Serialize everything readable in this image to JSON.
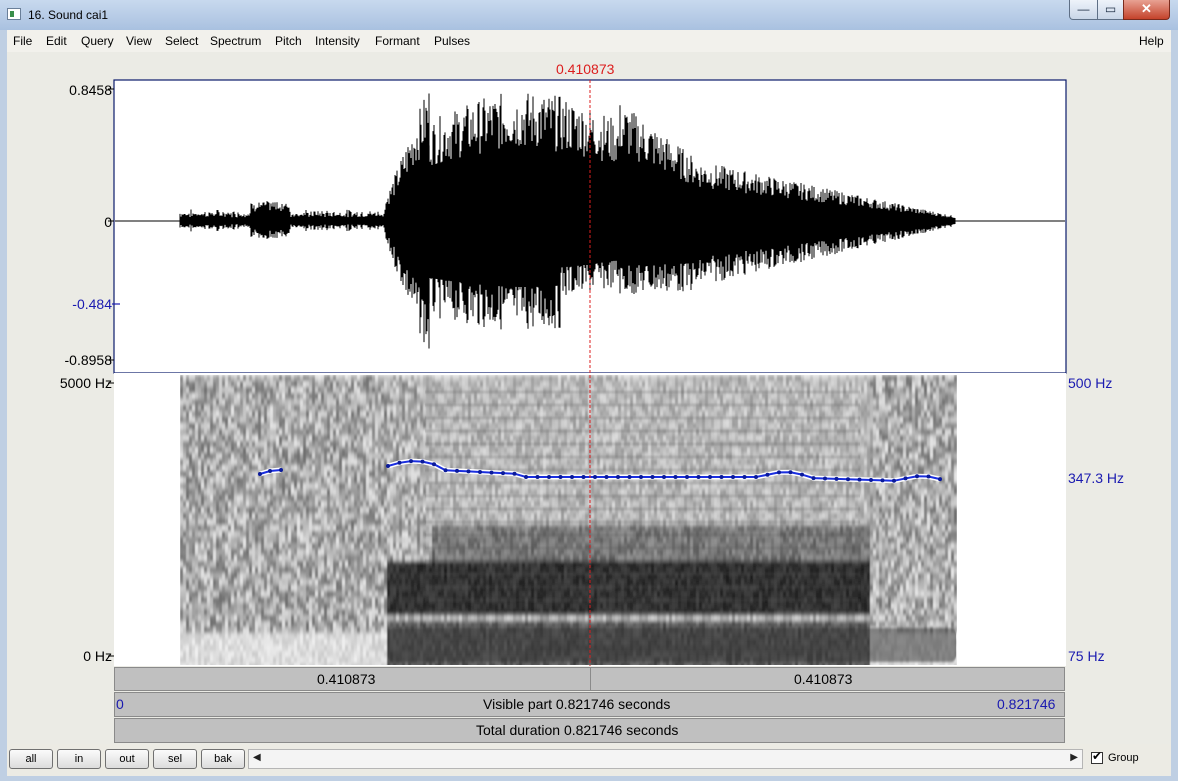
{
  "window": {
    "title": "16. Sound cai1",
    "min_glyph": "—",
    "max_glyph": "▭",
    "close_glyph": "✕"
  },
  "menu": [
    "File",
    "Edit",
    "Query",
    "View",
    "Select",
    "Spectrum",
    "Pitch",
    "Intensity",
    "Formant",
    "Pulses"
  ],
  "help_label": "Help",
  "cursor": {
    "time_label": "0.410873",
    "time": 0.410873
  },
  "waveform": {
    "y_top": "0.8458",
    "y_zero": "0",
    "y_bottom": "-0.8958",
    "marker": "-0.484"
  },
  "spectrogram": {
    "freq_top": "5000 Hz",
    "freq_bottom": "0 Hz",
    "pitch_top": "500 Hz",
    "pitch_value": "347.3 Hz",
    "pitch_bottom": "75 Hz"
  },
  "bars": {
    "left_time": "0.410873",
    "right_time": "0.410873",
    "visible_start": "0",
    "visible_end": "0.821746",
    "visible_text": "Visible part 0.821746 seconds",
    "total_text": "Total duration 0.821746 seconds"
  },
  "buttons": [
    "all",
    "in",
    "out",
    "sel",
    "bak"
  ],
  "group": {
    "label": "Group",
    "checked": true,
    "check_glyph": "✔"
  },
  "scroll": {
    "left_arrow": "◀",
    "right_arrow": "▶"
  },
  "colors": {
    "cursor": "#dc1e1e",
    "pitch": "#1a2ee0",
    "axis_blue": "#1a1ab0"
  }
}
